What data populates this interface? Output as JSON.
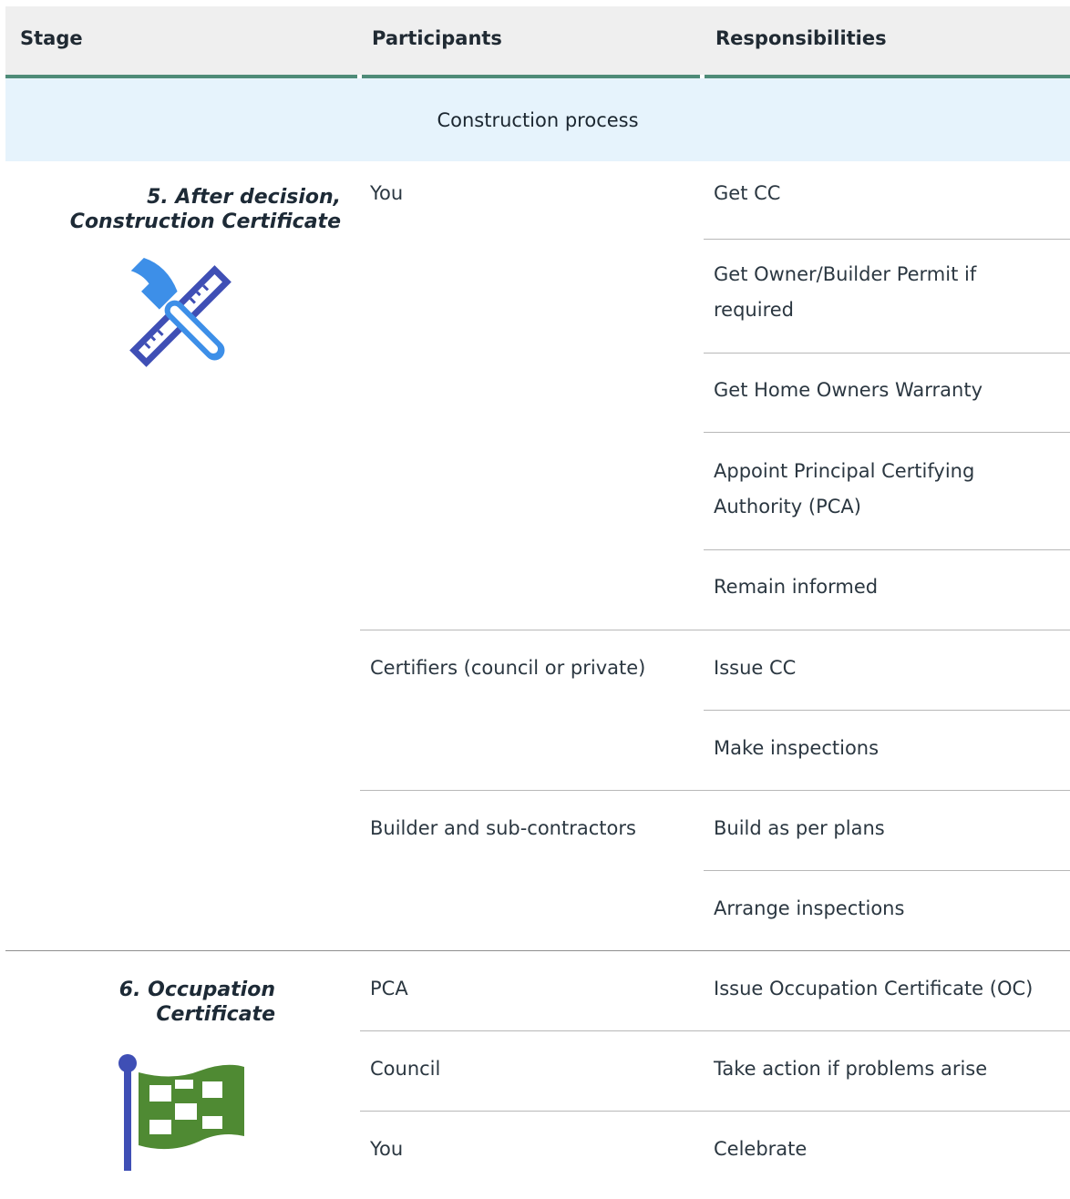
{
  "header": {
    "stage": "Stage",
    "participants": "Participants",
    "responsibilities": "Responsibilities"
  },
  "section": {
    "title": "Construction process"
  },
  "stages": [
    {
      "title_line1": "5. After decision,",
      "title_line2": "Construction Certificate",
      "icon": "hammer-ruler-icon",
      "groups": [
        {
          "participant": "You",
          "responsibilities": [
            "Get CC",
            "Get Owner/Builder Permit if required",
            "Get Home Owners Warranty",
            "Appoint Principal Certifying Authority (PCA)",
            "Remain informed"
          ]
        },
        {
          "participant": "Certifiers (council or private)",
          "responsibilities": [
            "Issue CC",
            "Make inspections"
          ]
        },
        {
          "participant": "Builder and sub-contractors",
          "responsibilities": [
            "Build as per plans",
            "Arrange inspections"
          ]
        }
      ]
    },
    {
      "title_line1": "6. Occupation",
      "title_line2": "Certificate",
      "icon": "checkered-flag-icon",
      "groups": [
        {
          "participant": "PCA",
          "responsibilities": [
            "Issue Occupation Certificate (OC)"
          ]
        },
        {
          "participant": "Council",
          "responsibilities": [
            "Take action if problems arise"
          ]
        },
        {
          "participant": "You",
          "responsibilities": [
            "Celebrate"
          ]
        }
      ]
    }
  ],
  "colors": {
    "header_bg": "#efefef",
    "header_rule": "#4e8b78",
    "banner_bg": "#e6f3fc",
    "hammer_blue": "#3d8fe8",
    "ruler_indigo": "#3f4fb5",
    "flag_green": "#4f8a33",
    "pole_blue": "#3f4fb5"
  }
}
